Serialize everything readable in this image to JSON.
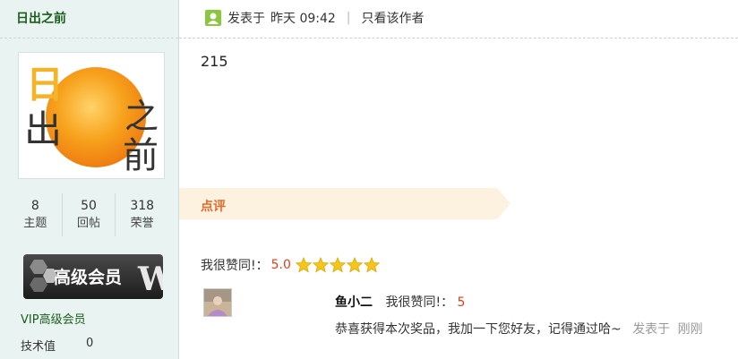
{
  "sidebar": {
    "username": "日出之前",
    "avatar_glyphs": [
      "日",
      "出",
      "之",
      "前"
    ],
    "stats": [
      {
        "value": "8",
        "label": "主题"
      },
      {
        "value": "50",
        "label": "回帖"
      },
      {
        "value": "318",
        "label": "荣誉"
      }
    ],
    "badge_text": "高级会员",
    "group": "VIP高级会员",
    "tech_label": "技术值",
    "tech_value": "0"
  },
  "post": {
    "posted_label": "发表于",
    "posted_time": "昨天 09:42",
    "separator": "|",
    "only_author": "只看该作者",
    "body": "215"
  },
  "rating": {
    "section_label": "点评",
    "agree_label": "我很赞同!：",
    "agree_score": "5.0",
    "stars_count": 5
  },
  "comment": {
    "name": "鱼小二",
    "agree_label": "我很赞同!：",
    "score": "5",
    "text": "恭喜获得本次奖品，我加一下您好友，记得通过哈~",
    "posted_label": "发表于",
    "posted_time": "刚刚"
  },
  "colors": {
    "sidebar_bg": "#e8f3f2",
    "username": "#1a5e1a",
    "accent_orange": "#e06b2c",
    "score_red": "#d9401c",
    "banner_bg": "#fdf2df",
    "star_gold": "#f5c518"
  }
}
